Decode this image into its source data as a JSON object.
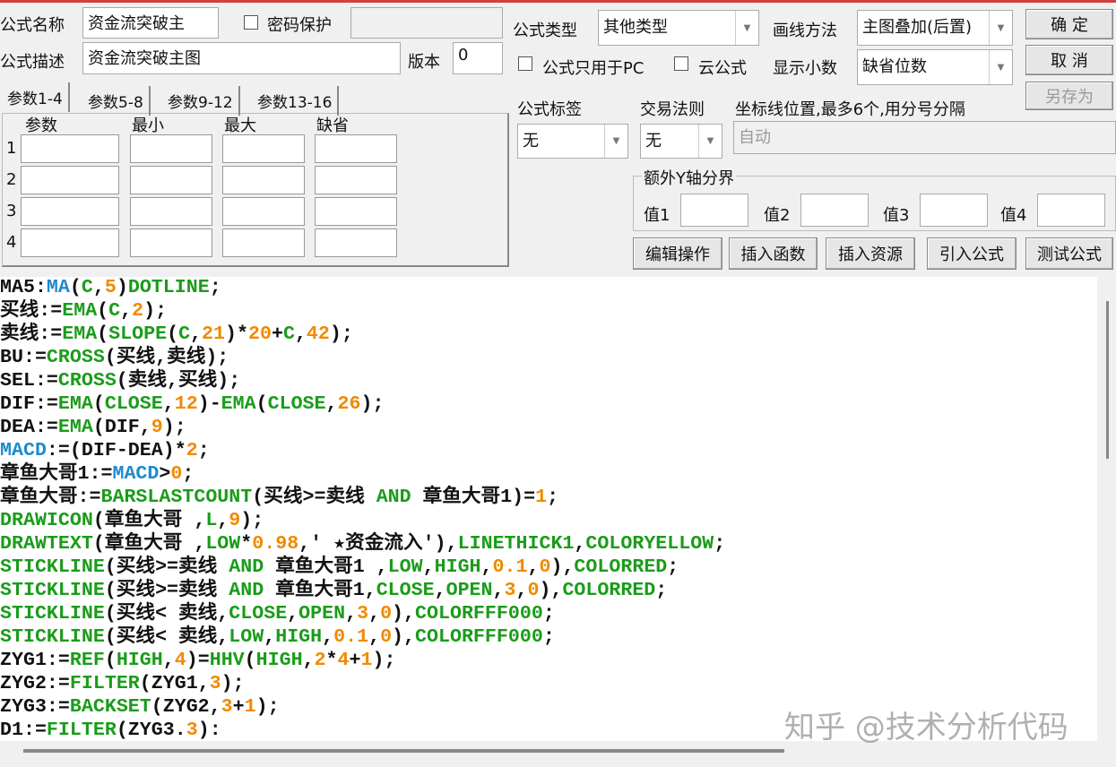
{
  "header": {
    "name_label": "公式名称",
    "name_value": "资金流突破主",
    "password_label": "密码保护",
    "desc_label": "公式描述",
    "desc_value": "资金流突破主图",
    "version_label": "版本",
    "version_value": "0",
    "type_label": "公式类型",
    "type_value": "其他类型",
    "draw_label": "画线方法",
    "draw_value": "主图叠加(后置)",
    "pc_only_label": "公式只用于PC",
    "cloud_label": "云公式",
    "decimals_label": "显示小数",
    "decimals_value": "缺省位数",
    "ok": "确 定",
    "cancel": "取 消",
    "save_as": "另存为"
  },
  "params": {
    "tabs": [
      "参数1-4",
      "参数5-8",
      "参数9-12",
      "参数13-16"
    ],
    "columns": [
      "参数",
      "最小",
      "最大",
      "缺省"
    ],
    "rows": [
      "1",
      "2",
      "3",
      "4"
    ]
  },
  "options": {
    "tag_label": "公式标签",
    "tag_value": "无",
    "rule_label": "交易法则",
    "rule_value": "无",
    "axis_label": "坐标线位置,最多6个,用分号分隔",
    "axis_placeholder": "自动",
    "yaxis_group": "额外Y轴分界",
    "values": [
      "值1",
      "值2",
      "值3",
      "值4"
    ]
  },
  "actions": [
    "编辑操作",
    "插入函数",
    "插入资源",
    "引入公式",
    "测试公式"
  ],
  "code": [
    [
      [
        "MA5:",
        "k"
      ],
      [
        "MA",
        "b"
      ],
      [
        "(",
        "k"
      ],
      [
        "C",
        "g"
      ],
      [
        ",",
        "k"
      ],
      [
        "5",
        "o"
      ],
      [
        ")",
        "k"
      ],
      [
        "DOTLINE",
        "g"
      ],
      [
        ";",
        "k"
      ]
    ],
    [
      [
        "买线:=",
        "k"
      ],
      [
        "EMA",
        "g"
      ],
      [
        "(",
        "k"
      ],
      [
        "C",
        "g"
      ],
      [
        ",",
        "k"
      ],
      [
        "2",
        "o"
      ],
      [
        ");",
        "k"
      ]
    ],
    [
      [
        "卖线:=",
        "k"
      ],
      [
        "EMA",
        "g"
      ],
      [
        "(",
        "k"
      ],
      [
        "SLOPE",
        "g"
      ],
      [
        "(",
        "k"
      ],
      [
        "C",
        "g"
      ],
      [
        ",",
        "k"
      ],
      [
        "21",
        "o"
      ],
      [
        ")*",
        "k"
      ],
      [
        "20",
        "o"
      ],
      [
        "+",
        "k"
      ],
      [
        "C",
        "g"
      ],
      [
        ",",
        "k"
      ],
      [
        "42",
        "o"
      ],
      [
        ");",
        "k"
      ]
    ],
    [
      [
        "BU:=",
        "k"
      ],
      [
        "CROSS",
        "g"
      ],
      [
        "(买线,卖线);",
        "k"
      ]
    ],
    [
      [
        "SEL:=",
        "k"
      ],
      [
        "CROSS",
        "g"
      ],
      [
        "(卖线,买线);",
        "k"
      ]
    ],
    [
      [
        "DIF:=",
        "k"
      ],
      [
        "EMA",
        "g"
      ],
      [
        "(",
        "k"
      ],
      [
        "CLOSE",
        "g"
      ],
      [
        ",",
        "k"
      ],
      [
        "12",
        "o"
      ],
      [
        ")-",
        "k"
      ],
      [
        "EMA",
        "g"
      ],
      [
        "(",
        "k"
      ],
      [
        "CLOSE",
        "g"
      ],
      [
        ",",
        "k"
      ],
      [
        "26",
        "o"
      ],
      [
        ");",
        "k"
      ]
    ],
    [
      [
        "DEA:=",
        "k"
      ],
      [
        "EMA",
        "g"
      ],
      [
        "(DIF,",
        "k"
      ],
      [
        "9",
        "o"
      ],
      [
        ");",
        "k"
      ]
    ],
    [
      [
        "MACD",
        "b"
      ],
      [
        ":=(DIF-DEA)*",
        "k"
      ],
      [
        "2",
        "o"
      ],
      [
        ";",
        "k"
      ]
    ],
    [
      [
        "章鱼大哥1:=",
        "k"
      ],
      [
        "MACD",
        "b"
      ],
      [
        ">",
        "k"
      ],
      [
        "0",
        "o"
      ],
      [
        ";",
        "k"
      ]
    ],
    [
      [
        "章鱼大哥:=",
        "k"
      ],
      [
        "BARSLASTCOUNT",
        "g"
      ],
      [
        "(买线>=卖线 ",
        "k"
      ],
      [
        "AND",
        "g"
      ],
      [
        " 章鱼大哥1)=",
        "k"
      ],
      [
        "1",
        "o"
      ],
      [
        ";",
        "k"
      ]
    ],
    [
      [
        "DRAWICON",
        "g"
      ],
      [
        "(章鱼大哥 ,",
        "k"
      ],
      [
        "L",
        "g"
      ],
      [
        ",",
        "k"
      ],
      [
        "9",
        "o"
      ],
      [
        ");",
        "k"
      ]
    ],
    [
      [
        "DRAWTEXT",
        "g"
      ],
      [
        "(章鱼大哥 ,",
        "k"
      ],
      [
        "LOW",
        "g"
      ],
      [
        "*",
        "k"
      ],
      [
        "0.98",
        "o"
      ],
      [
        ",' ★资金流入'),",
        "k"
      ],
      [
        "LINETHICK1",
        "g"
      ],
      [
        ",",
        "k"
      ],
      [
        "COLORYELLOW",
        "g"
      ],
      [
        ";",
        "k"
      ]
    ],
    [
      [
        "STICKLINE",
        "g"
      ],
      [
        "(买线>=卖线 ",
        "k"
      ],
      [
        "AND",
        "g"
      ],
      [
        " 章鱼大哥1 ,",
        "k"
      ],
      [
        "LOW",
        "g"
      ],
      [
        ",",
        "k"
      ],
      [
        "HIGH",
        "g"
      ],
      [
        ",",
        "k"
      ],
      [
        "0.1",
        "o"
      ],
      [
        ",",
        "k"
      ],
      [
        "0",
        "o"
      ],
      [
        "),",
        "k"
      ],
      [
        "COLORRED",
        "g"
      ],
      [
        ";",
        "k"
      ]
    ],
    [
      [
        "STICKLINE",
        "g"
      ],
      [
        "(买线>=卖线 ",
        "k"
      ],
      [
        "AND",
        "g"
      ],
      [
        " 章鱼大哥1,",
        "k"
      ],
      [
        "CLOSE",
        "g"
      ],
      [
        ",",
        "k"
      ],
      [
        "OPEN",
        "g"
      ],
      [
        ",",
        "k"
      ],
      [
        "3",
        "o"
      ],
      [
        ",",
        "k"
      ],
      [
        "0",
        "o"
      ],
      [
        "),",
        "k"
      ],
      [
        "COLORRED",
        "g"
      ],
      [
        ";",
        "k"
      ]
    ],
    [
      [
        "STICKLINE",
        "g"
      ],
      [
        "(买线< 卖线,",
        "k"
      ],
      [
        "CLOSE",
        "g"
      ],
      [
        ",",
        "k"
      ],
      [
        "OPEN",
        "g"
      ],
      [
        ",",
        "k"
      ],
      [
        "3",
        "o"
      ],
      [
        ",",
        "k"
      ],
      [
        "0",
        "o"
      ],
      [
        "),",
        "k"
      ],
      [
        "COLORFFF000",
        "g"
      ],
      [
        ";",
        "k"
      ]
    ],
    [
      [
        "STICKLINE",
        "g"
      ],
      [
        "(买线< 卖线,",
        "k"
      ],
      [
        "LOW",
        "g"
      ],
      [
        ",",
        "k"
      ],
      [
        "HIGH",
        "g"
      ],
      [
        ",",
        "k"
      ],
      [
        "0.1",
        "o"
      ],
      [
        ",",
        "k"
      ],
      [
        "0",
        "o"
      ],
      [
        "),",
        "k"
      ],
      [
        "COLORFFF000",
        "g"
      ],
      [
        ";",
        "k"
      ]
    ],
    [
      [
        "ZYG1:=",
        "k"
      ],
      [
        "REF",
        "g"
      ],
      [
        "(",
        "k"
      ],
      [
        "HIGH",
        "g"
      ],
      [
        ",",
        "k"
      ],
      [
        "4",
        "o"
      ],
      [
        ")=",
        "k"
      ],
      [
        "HHV",
        "g"
      ],
      [
        "(",
        "k"
      ],
      [
        "HIGH",
        "g"
      ],
      [
        ",",
        "k"
      ],
      [
        "2",
        "o"
      ],
      [
        "*",
        "k"
      ],
      [
        "4",
        "o"
      ],
      [
        "+",
        "k"
      ],
      [
        "1",
        "o"
      ],
      [
        ");",
        "k"
      ]
    ],
    [
      [
        "ZYG2:=",
        "k"
      ],
      [
        "FILTER",
        "g"
      ],
      [
        "(ZYG1,",
        "k"
      ],
      [
        "3",
        "o"
      ],
      [
        ");",
        "k"
      ]
    ],
    [
      [
        "ZYG3:=",
        "k"
      ],
      [
        "BACKSET",
        "g"
      ],
      [
        "(ZYG2,",
        "k"
      ],
      [
        "3",
        "o"
      ],
      [
        "+",
        "k"
      ],
      [
        "1",
        "o"
      ],
      [
        ");",
        "k"
      ]
    ],
    [
      [
        "D1:=",
        "k"
      ],
      [
        "FILTER",
        "g"
      ],
      [
        "(ZYG3.",
        "k"
      ],
      [
        "3",
        "o"
      ],
      [
        "):",
        "k"
      ]
    ]
  ],
  "watermark": "知乎 @技术分析代码"
}
